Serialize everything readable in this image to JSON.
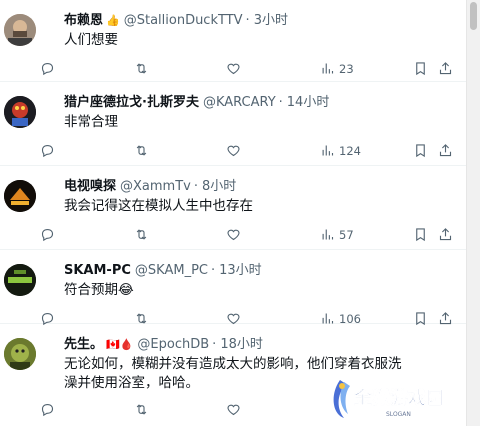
{
  "tweets": [
    {
      "name": "布赖恩",
      "badge": "👍",
      "handle": "@StallionDuckTTV",
      "dot": "·",
      "time": "3小时",
      "text": "人们想要",
      "views": "23"
    },
    {
      "name": "猎户座德拉戈·扎斯罗夫",
      "badge": "",
      "handle": "@KARCARY",
      "dot": "·",
      "time": "14小时",
      "text": "非常合理",
      "views": "124"
    },
    {
      "name": "电视嗅探",
      "badge": "",
      "handle": "@XammTv",
      "dot": "·",
      "time": "8小时",
      "text": "我会记得这在模拟人生中也存在",
      "views": "57"
    },
    {
      "name": "SKAM-PC",
      "badge": "",
      "handle": "@SKAM_PC",
      "dot": "·",
      "time": "13小时",
      "text": "符合预期😂",
      "views": "106"
    },
    {
      "name": "先生。",
      "badge": "🇨🇦🩸",
      "handle": "@EpochDB",
      "dot": "·",
      "time": "18小时",
      "text": "无论如何，模糊并没有造成太大的影响，他们穿着衣服洗澡并使用浴室，哈哈。",
      "views": ""
    }
  ],
  "watermark": {
    "text": "金猴游戏园",
    "slogan": "SLOGAN"
  },
  "colors": {
    "text": "#0f1419",
    "muted": "#536471",
    "divider": "#eff3f4",
    "accent": "#1d9bf0"
  },
  "icons": [
    "reply-icon",
    "retweet-icon",
    "like-icon",
    "views-icon",
    "bookmark-icon",
    "share-icon"
  ]
}
